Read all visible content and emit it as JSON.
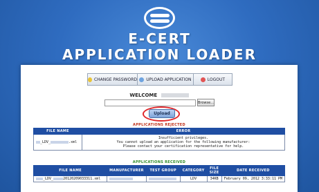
{
  "brand": {
    "line1": "E-CERT",
    "line2": "APPLICATION LOADER"
  },
  "toolbar": {
    "items": [
      {
        "label": "CHANGE PASSWORD",
        "icon": "pencil-icon"
      },
      {
        "label": "UPLOAD APPLICATION",
        "icon": "upload-icon"
      },
      {
        "label": "LOGOUT",
        "icon": "logout-icon"
      }
    ]
  },
  "welcome": {
    "label": "WELCOME"
  },
  "upload_form": {
    "browse_label": "Browse...",
    "upload_label": "Upload"
  },
  "rejected": {
    "title": "APPLICATIONS REJECTED",
    "headers": [
      "FILE NAME",
      "ERROR"
    ],
    "rows": [
      {
        "file_prefix": "_LDV_",
        "file_suffix": ".xml",
        "error_lines": [
          "Insufficient privileges.",
          "You cannot upload an application for the following manufacturer:",
          "Please contact your certification representative for help."
        ]
      }
    ]
  },
  "received": {
    "title": "APPLICATIONS RECEIVED",
    "headers": [
      "FILE NAME",
      "MANUFACTURER",
      "TEST GROUP",
      "CATEGORY",
      "FILE SIZE",
      "DATE RECEIVED"
    ],
    "rows": [
      {
        "file_prefix": "_LDV_",
        "file_suffix": "20120209033311.xml",
        "category": "LDV",
        "file_size": "34KB",
        "date": "February 09, 2012 3:33:11 PM"
      }
    ]
  },
  "colors": {
    "accent": "#1f4ea3",
    "rejected_title": "#c03018",
    "received_title": "#2d8a26",
    "highlight": "#e0262a"
  }
}
